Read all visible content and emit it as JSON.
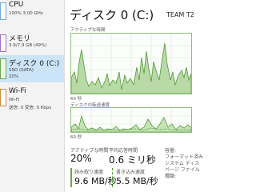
{
  "sidebar": {
    "items": [
      {
        "title": "CPU",
        "sub1": "100%  3.00 GHz",
        "sub2": "",
        "icon": "cpu-graph-icon",
        "selected": false
      },
      {
        "title": "メモリ",
        "sub1": "3.9/7.9 GB (49%)",
        "sub2": "",
        "icon": "memory-graph-icon",
        "selected": false
      },
      {
        "title": "ディスク 0 (C:)",
        "sub1": "SSD (SATA)",
        "sub2": "20%",
        "icon": "disk-graph-icon",
        "selected": true
      },
      {
        "title": "Wi-Fi",
        "sub1": "Wi-Fi",
        "sub2": "送信: 0 受信: 0 Kbps",
        "icon": "wifi-graph-icon",
        "selected": false
      }
    ]
  },
  "header": {
    "title": "ディスク 0 (C:)",
    "model": "TEAM T2"
  },
  "graphs": {
    "active_time": {
      "label": "アクティブな時間",
      "x_label": "60 秒"
    },
    "transfer": {
      "label": "ディスクの転送速度",
      "x_label": "60 秒"
    }
  },
  "stats": {
    "active_time_label": "アクティブな時間",
    "active_time_value": "20%",
    "avg_response_label": "平均応答時間",
    "avg_response_value": "0.6 ミリ秒",
    "read_speed_label": "読み取り速度",
    "read_speed_value": "9.6 MB/秒",
    "write_speed_label": "書き込み速度",
    "write_speed_value": "5.5 MB/秒"
  },
  "right_props": [
    "容量:",
    "フォーマット済み",
    "システム ディス",
    "ページ ファイル",
    "種類:"
  ],
  "colors": {
    "accent": "#6aa84f",
    "selected": "#cce4f7"
  }
}
